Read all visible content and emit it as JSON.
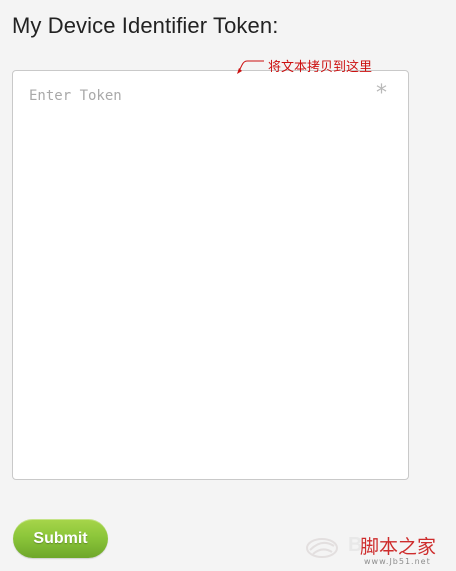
{
  "form": {
    "title": "My Device Identifier Token:",
    "token_placeholder": "Enter Token",
    "token_value": "",
    "required_mark": "*",
    "submit_label": "Submit"
  },
  "annotation": {
    "text": "将文本拷贝到这里",
    "color": "#cc1010"
  },
  "watermark": {
    "ghost_text": "B",
    "site_name": "脚本之家",
    "url": "www.Jb51.net",
    "brand_color": "#cc2222"
  },
  "colors": {
    "background": "#f4f4f4",
    "button_green": "#8cc63a"
  }
}
